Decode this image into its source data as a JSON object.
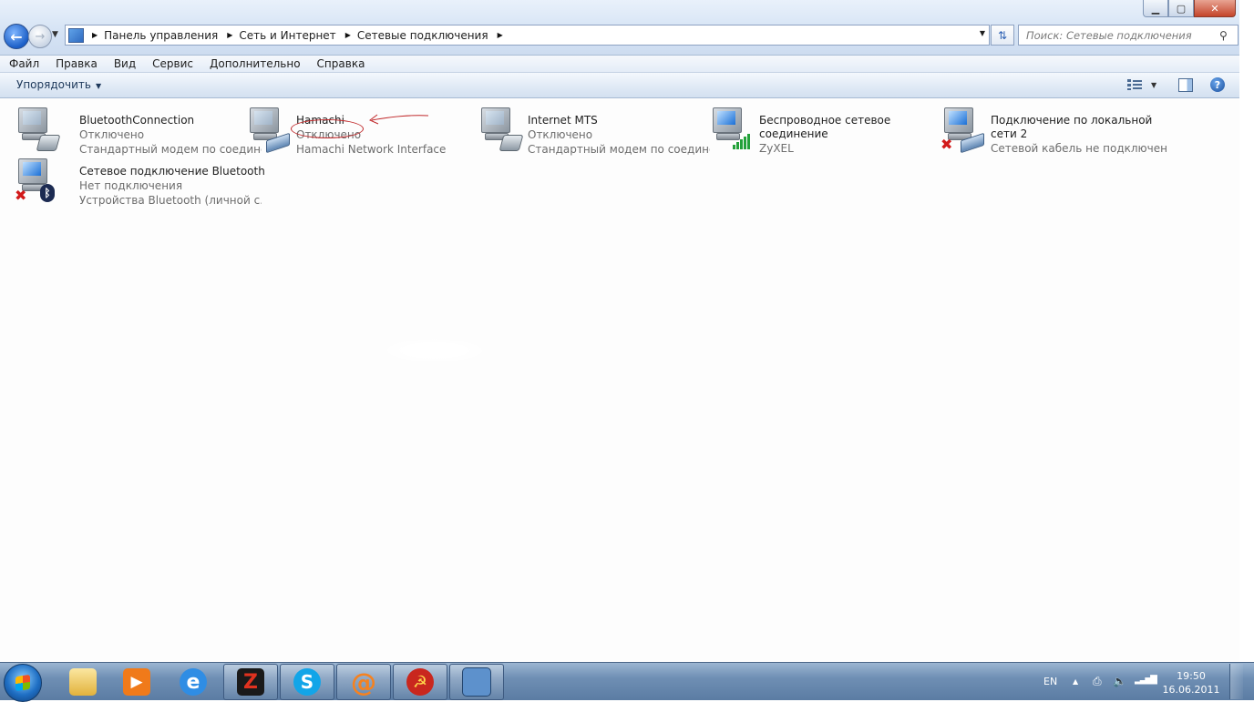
{
  "window": {
    "controls": {
      "minimize": "▁",
      "maximize": "▢",
      "close": "✕"
    }
  },
  "address": {
    "crumbs": [
      "Панель управления",
      "Сеть и Интернет",
      "Сетевые подключения"
    ]
  },
  "search": {
    "placeholder": "Поиск: Сетевые подключения"
  },
  "menu": [
    "Файл",
    "Правка",
    "Вид",
    "Сервис",
    "Дополнительно",
    "Справка"
  ],
  "toolbar": {
    "organize": "Упорядочить"
  },
  "connections": [
    {
      "name": "BluetoothConnection",
      "status": "Отключено",
      "device": "Стандартный модем по соедине...",
      "icon": "modem-icon"
    },
    {
      "name": "Hamachi",
      "status": "Отключено",
      "device": "Hamachi Network Interface",
      "icon": "network-adapter-icon"
    },
    {
      "name": "Internet MTS",
      "status": "Отключено",
      "device": "Стандартный модем по соедине...",
      "icon": "modem-icon"
    },
    {
      "name": "Беспроводное сетевое соединение",
      "status": "",
      "device": "ZyXEL",
      "icon": "wifi-signal-icon"
    },
    {
      "name": "Подключение по локальной сети 2",
      "status": "",
      "device": "Сетевой кабель не подключен",
      "icon": "network-adapter-icon"
    },
    {
      "name": "Сетевое подключение Bluetooth",
      "status": "Нет подключения",
      "device": "Устройства Bluetooth (личной с...",
      "icon": "bluetooth-icon"
    }
  ],
  "taskbar": {
    "apps": [
      {
        "name": "explorer",
        "label": "",
        "color": "#f2c85b"
      },
      {
        "name": "media-player",
        "label": "▶",
        "color": "#f07a1a"
      },
      {
        "name": "internet-explorer",
        "label": "e",
        "color": "#2f8de4"
      },
      {
        "name": "game",
        "label": "Z",
        "color": "#b31a12"
      },
      {
        "name": "skype",
        "label": "S",
        "color": "#12a5e8"
      },
      {
        "name": "mail-agent",
        "label": "@",
        "color": "#f58220"
      },
      {
        "name": "red-star-app",
        "label": "☭",
        "color": "#c9271e"
      },
      {
        "name": "network-connections",
        "label": "",
        "color": "#5d91cc"
      }
    ]
  },
  "tray": {
    "language": "EN",
    "time": "19:50",
    "date": "16.06.2011"
  }
}
